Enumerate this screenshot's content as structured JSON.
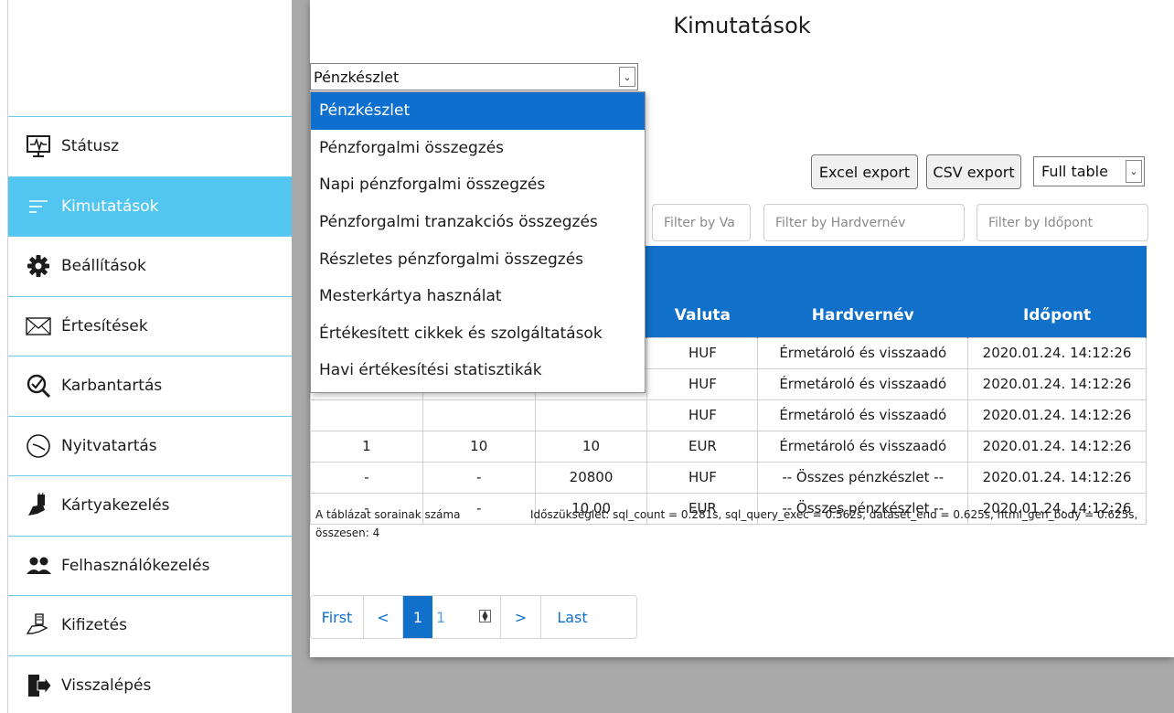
{
  "page": {
    "title": "Kimutatások"
  },
  "sidebar": {
    "items": [
      {
        "label": "Státusz",
        "icon": "monitor-pulse-icon",
        "active": false
      },
      {
        "label": "Kimutatások",
        "icon": "list-lines-icon",
        "active": true
      },
      {
        "label": "Beállítások",
        "icon": "gear-icon",
        "active": false
      },
      {
        "label": "Értesítések",
        "icon": "envelope-icon",
        "active": false
      },
      {
        "label": "Karbantartás",
        "icon": "search-check-icon",
        "active": false
      },
      {
        "label": "Nyitvatartás",
        "icon": "clock-icon",
        "active": false
      },
      {
        "label": "Kártyakezelés",
        "icon": "card-hand-icon",
        "active": false
      },
      {
        "label": "Felhasználókezelés",
        "icon": "users-icon",
        "active": false
      },
      {
        "label": "Kifizetés",
        "icon": "cash-hand-icon",
        "active": false
      },
      {
        "label": "Visszalépés",
        "icon": "logout-icon",
        "active": false
      }
    ]
  },
  "report_select": {
    "value": "Pénzkészlet",
    "options": [
      "Pénzkészlet",
      "Pénzforgalmi összegzés",
      "Napi pénzforgalmi összegzés",
      "Pénzforgalmi tranzakciós összegzés",
      "Részletes pénzforgalmi összegzés",
      "Mesterkártya használat",
      "Értékesített cikkek és szolgáltatások",
      "Havi értékesítési statisztikák"
    ]
  },
  "toolbar": {
    "excel_label": "Excel export",
    "csv_label": "CSV export",
    "table_mode": "Full table"
  },
  "filters": {
    "valuta_placeholder": "Filter by Va",
    "hardware_placeholder": "Filter by Hardvernév",
    "timestamp_placeholder": "Filter by Időpont"
  },
  "table": {
    "columns": [
      "",
      "",
      "",
      "Valuta",
      "Hardvernév",
      "Időpont"
    ],
    "rows": [
      [
        "",
        "",
        "",
        "HUF",
        "Érmetároló és visszaadó",
        "2020.01.24. 14:12:26"
      ],
      [
        "",
        "",
        "",
        "HUF",
        "Érmetároló és visszaadó",
        "2020.01.24. 14:12:26"
      ],
      [
        "",
        "",
        "",
        "HUF",
        "Érmetároló és visszaadó",
        "2020.01.24. 14:12:26"
      ],
      [
        "1",
        "10",
        "10",
        "EUR",
        "Érmetároló és visszaadó",
        "2020.01.24. 14:12:26"
      ],
      [
        "-",
        "-",
        "20800",
        "HUF",
        "-- Összes pénzkészlet --",
        "2020.01.24. 14:12:26"
      ],
      [
        "-",
        "-",
        "10.00",
        "EUR",
        "-- Összes pénzkészlet --",
        "2020.01.24. 14:12:26"
      ]
    ]
  },
  "footer": {
    "row_count": "A táblázat sorainak száma összesen: 4",
    "timing": "Időszükséglet: sql_count = 0.281s, sql_query_exec = 0.562s, dataset_end = 0.625s, html_gen_body = 0.625s,"
  },
  "pager": {
    "first": "First",
    "prev": "<",
    "current": "1",
    "input_value": "1",
    "next": ">",
    "last": "Last"
  },
  "colors": {
    "sidebar_active": "#52c5f1",
    "accent_blue": "#1170c9",
    "dropdown_selected": "#0f6fcf",
    "divider": "#6ccbe9"
  }
}
